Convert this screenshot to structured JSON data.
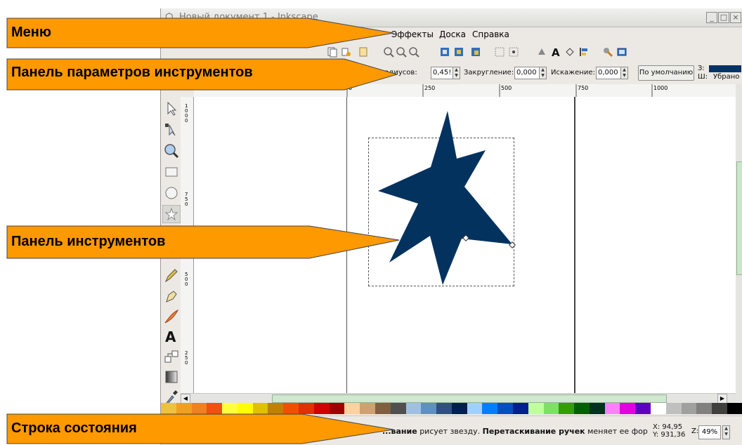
{
  "window": {
    "title": "Новый документ 1 - Inkscape",
    "controls": [
      "_",
      "□",
      "×"
    ]
  },
  "menubar": {
    "items": [
      "Эффекты",
      "Доска",
      "Справка"
    ]
  },
  "tool_controls": {
    "rounding_ratio_label": "радиусов:",
    "rounding_ratio_value": "0,45!",
    "rounding_label": "Закругление:",
    "rounding_value": "0,000",
    "distortion_label": "Искажение:",
    "distortion_value": "0,000",
    "default_button": "По умолчанию",
    "fill_label": "З:",
    "stroke_label": "Ш:",
    "stroke_value": "Убрано",
    "fill_color": "#003366"
  },
  "ruler": {
    "top_ticks": [
      "0",
      "250",
      "500",
      "750",
      "1000"
    ],
    "left_ticks": [
      "1\n0\n0\n0",
      "7\n5\n0",
      "5\n0\n0",
      "2\n5\n0"
    ]
  },
  "star": {
    "fill": "#04325f",
    "points": 7
  },
  "palette": [
    "#f0c040",
    "#f0a020",
    "#f08020",
    "#f05010",
    "#ffff40",
    "#ffff00",
    "#e0c000",
    "#c08000",
    "#f05000",
    "#e03000",
    "#d00000",
    "#a00000",
    "#ffd0a0",
    "#d0a070",
    "#806040",
    "#505050",
    "#a0c0e0",
    "#6090c0",
    "#305080",
    "#002050",
    "#a0d0ff",
    "#0080ff",
    "#0050c0",
    "#002090",
    "#c0ffa0",
    "#80e060",
    "#30a000",
    "#006000",
    "#003020",
    "#ff80ff",
    "#e000e0",
    "#6000c0",
    "#ffffff",
    "#c0c0c0",
    "#a0a0a0",
    "#808080",
    "#404040",
    "#000000"
  ],
  "statusbar": {
    "text_part1": "...вание",
    "text_part2": " рисует звезду. ",
    "text_bold2": "Перетаскивание ручек",
    "text_part3": " меняет ее фор",
    "x_label": "X:",
    "x_value": "94,95",
    "y_label": "Y:",
    "y_value": "931,36",
    "zoom_label": "Z:",
    "zoom_value": "49%"
  },
  "callouts": {
    "menu": "Меню",
    "tool_controls": "Панель параметров инструментов",
    "toolbox": "Панель инструментов",
    "statusbar": "Строка состояния",
    "color": "#ff9900"
  }
}
